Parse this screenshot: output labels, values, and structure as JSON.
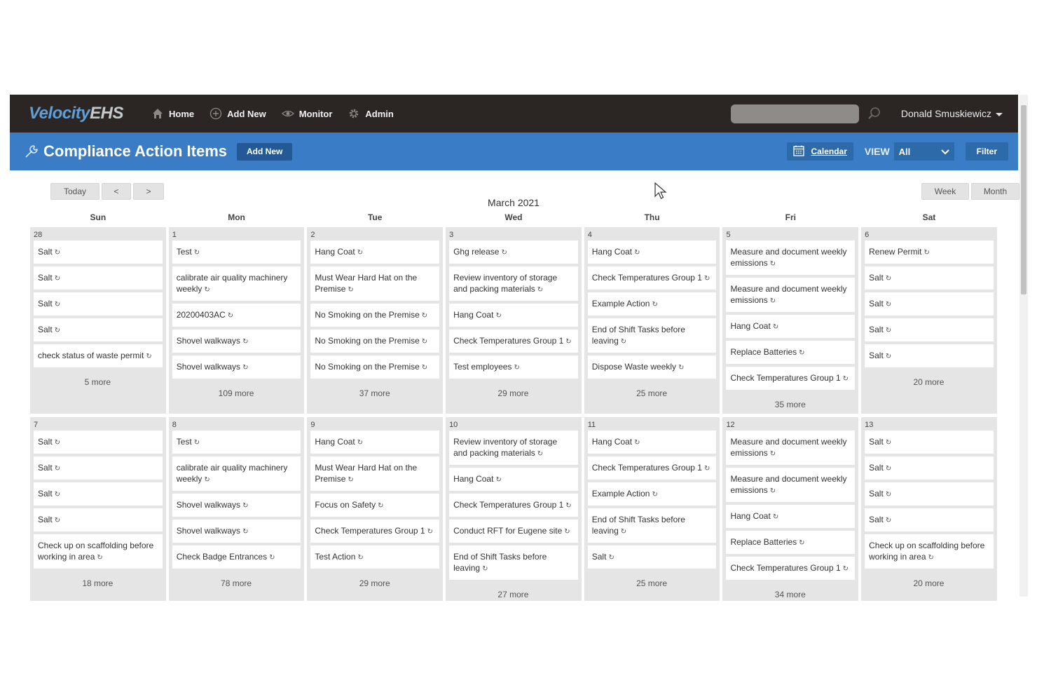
{
  "app": {
    "logo_primary": "Velocity",
    "logo_secondary": "EHS"
  },
  "nav": {
    "items": [
      {
        "label": "Home",
        "icon": "home-icon"
      },
      {
        "label": "Add New",
        "icon": "plus-circle-icon"
      },
      {
        "label": "Monitor",
        "icon": "eye-icon"
      },
      {
        "label": "Admin",
        "icon": "gear-icon"
      }
    ]
  },
  "search": {
    "placeholder": "",
    "value": ""
  },
  "user": {
    "name": "Donald Smuskiewicz"
  },
  "header": {
    "title": "Compliance Action Items",
    "add_new": "Add New",
    "calendar_label": "Calendar",
    "view_label": "VIEW",
    "view_value": "All",
    "filter_label": "Filter"
  },
  "controls": {
    "today": "Today",
    "prev": "<",
    "next": ">",
    "week": "Week",
    "month": "Month",
    "month_title": "March 2021"
  },
  "days_of_week": [
    "Sun",
    "Mon",
    "Tue",
    "Wed",
    "Thu",
    "Fri",
    "Sat"
  ],
  "weeks": [
    {
      "days": [
        {
          "num": "28",
          "events": [
            "Salt",
            "Salt",
            "Salt",
            "Salt",
            "check status of waste permit"
          ],
          "more": "5 more"
        },
        {
          "num": "1",
          "events": [
            "Test",
            "calibrate air quality machinery weekly",
            "20200403AC",
            "Shovel walkways",
            "Shovel walkways"
          ],
          "more": "109 more"
        },
        {
          "num": "2",
          "events": [
            "Hang Coat",
            "Must Wear Hard Hat on the Premise",
            "No Smoking on the Premise",
            "No Smoking on the Premise",
            "No Smoking on the Premise"
          ],
          "more": "37 more"
        },
        {
          "num": "3",
          "events": [
            "Ghg release",
            "Review inventory of storage and packing materials",
            "Hang Coat",
            "Check Temperatures Group 1",
            "Test employees"
          ],
          "more": "29 more"
        },
        {
          "num": "4",
          "events": [
            "Hang Coat",
            "Check Temperatures Group 1",
            "Example Action",
            "End of Shift Tasks before leaving",
            "Dispose Waste weekly"
          ],
          "more": "25 more"
        },
        {
          "num": "5",
          "events": [
            "Measure and document weekly emissions",
            "Measure and document weekly emissions",
            "Hang Coat",
            "Replace Batteries",
            "Check Temperatures Group 1"
          ],
          "more": "35 more"
        },
        {
          "num": "6",
          "events": [
            "Renew Permit",
            "Salt",
            "Salt",
            "Salt",
            "Salt"
          ],
          "more": "20 more"
        }
      ]
    },
    {
      "days": [
        {
          "num": "7",
          "events": [
            "Salt",
            "Salt",
            "Salt",
            "Salt",
            "Check up on scaffolding before working in area"
          ],
          "more": "18 more"
        },
        {
          "num": "8",
          "events": [
            "Test",
            "calibrate air quality machinery weekly",
            "Shovel walkways",
            "Shovel walkways",
            "Check Badge Entrances"
          ],
          "more": "78 more"
        },
        {
          "num": "9",
          "events": [
            "Hang Coat",
            "Must Wear Hard Hat on the Premise",
            "Focus on Safety",
            "Check Temperatures Group 1",
            "Test Action"
          ],
          "more": "29 more"
        },
        {
          "num": "10",
          "events": [
            "Review inventory of storage and packing materials",
            "Hang Coat",
            "Check Temperatures Group 1",
            "Conduct RFT for Eugene site",
            "End of Shift Tasks before leaving"
          ],
          "more": "27 more"
        },
        {
          "num": "11",
          "events": [
            "Hang Coat",
            "Check Temperatures Group 1",
            "Example Action",
            "End of Shift Tasks before leaving",
            "Salt"
          ],
          "more": "25 more"
        },
        {
          "num": "12",
          "events": [
            "Measure and document weekly emissions",
            "Measure and document weekly emissions",
            "Hang Coat",
            "Replace Batteries",
            "Check Temperatures Group 1"
          ],
          "more": "34 more"
        },
        {
          "num": "13",
          "events": [
            "Salt",
            "Salt",
            "Salt",
            "Salt",
            "Check up on scaffolding before working in area"
          ],
          "more": "20 more"
        }
      ]
    }
  ],
  "colors": {
    "topbar": "#2b2624",
    "titlebar": "#3a7dc6",
    "button_dark": "#235a95",
    "day_bg": "#e5e5e5"
  }
}
